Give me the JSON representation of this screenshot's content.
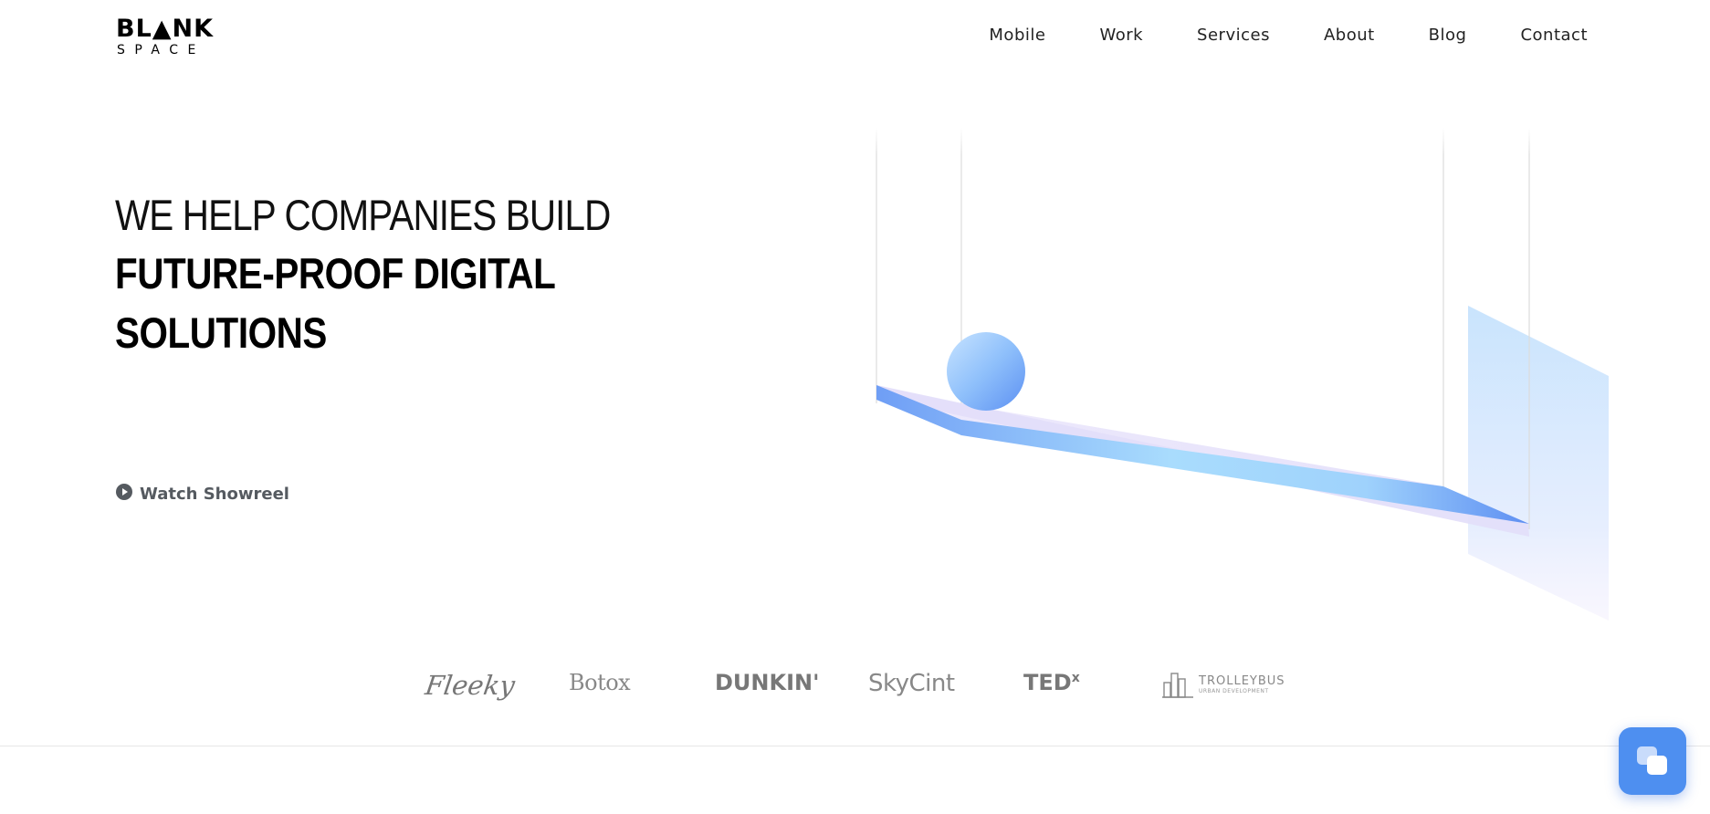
{
  "brand": {
    "logo_top": "BL▲NK",
    "logo_bottom": "SPACE"
  },
  "nav": {
    "items": [
      "Mobile",
      "Work",
      "Services",
      "About",
      "Blog",
      "Contact"
    ]
  },
  "hero": {
    "line1": "WE HELP COMPANIES BUILD",
    "line2": "FUTURE-PROOF DIGITAL",
    "line3": "SOLUTIONS",
    "showreel_label": "Watch Showreel"
  },
  "client_logos": [
    "Fleeky",
    "Botox",
    "DUNKIN'",
    "SkyCint",
    "TED",
    "TROLLEYBUS"
  ],
  "client_logo_extras": {
    "ted_superscript": "x",
    "trolleybus_sub": "URBAN DEVELOPMENT"
  },
  "colors": {
    "accent": "#4e8ff0",
    "text": "#111111",
    "muted": "#7c7c7c"
  },
  "icons": {
    "showreel": "play-circle-icon",
    "chat": "chat-bubbles-icon"
  }
}
